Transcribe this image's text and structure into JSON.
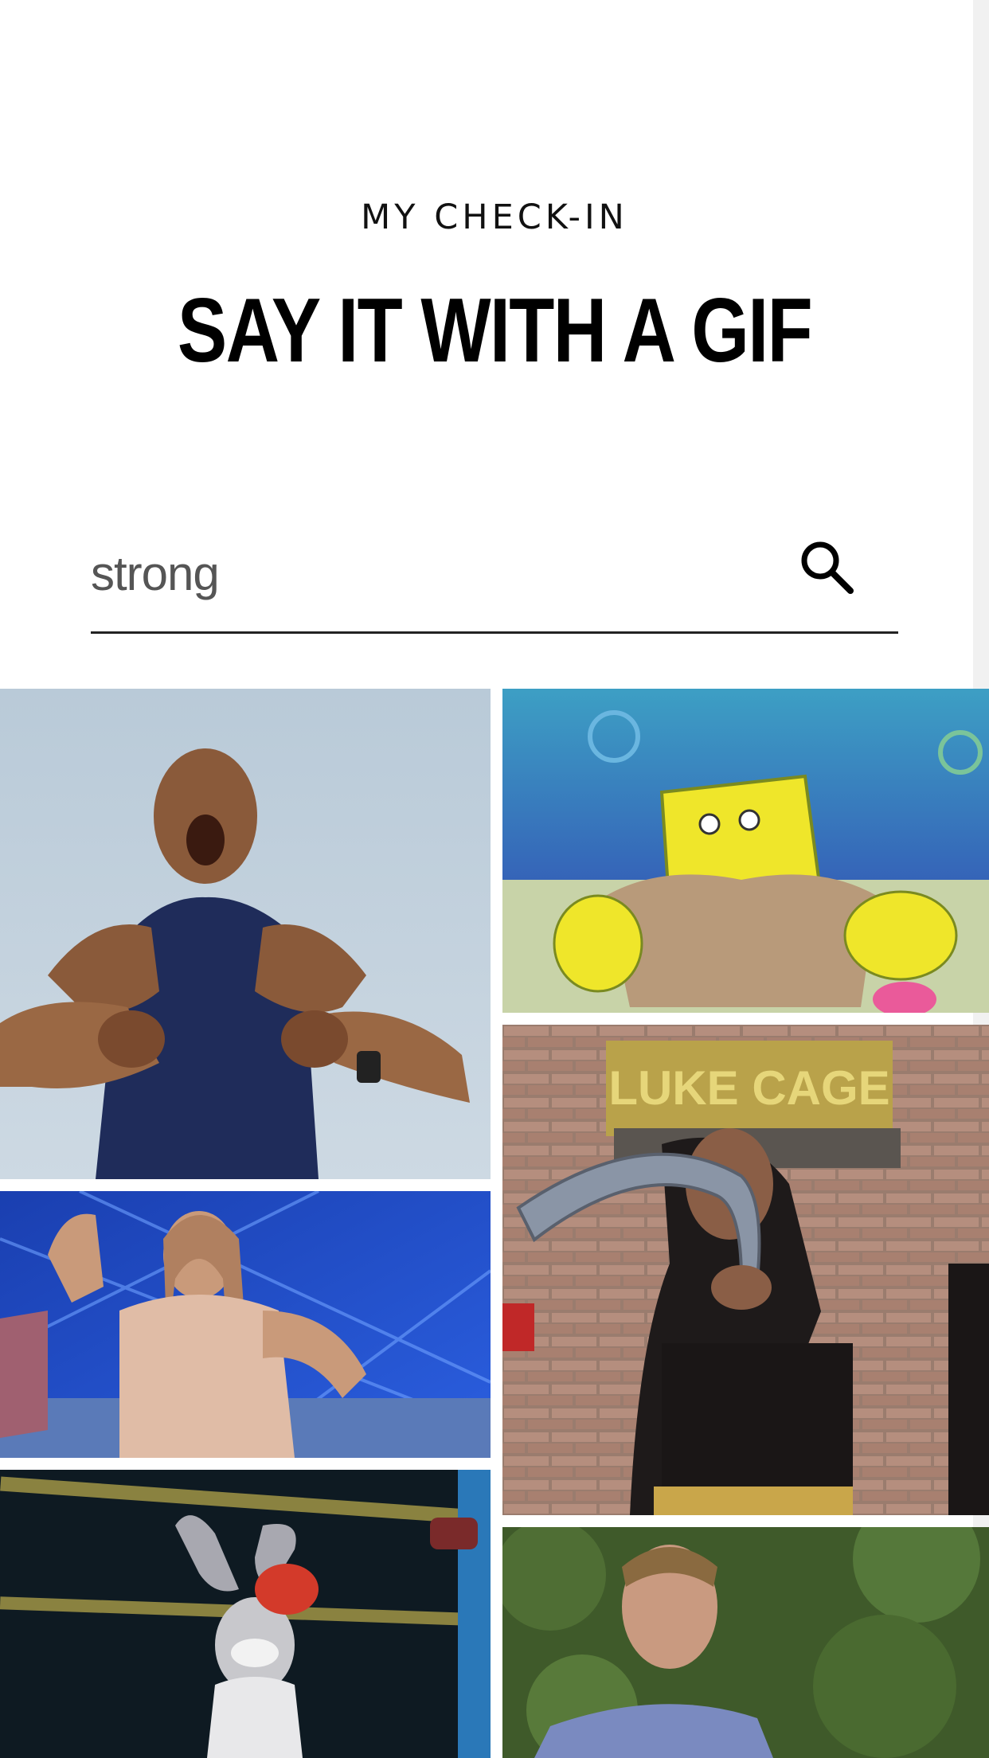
{
  "header": {
    "eyebrow": "MY CHECK-IN",
    "title": "SAY IT WITH A GIF"
  },
  "search": {
    "value": "strong",
    "icon": "search-icon"
  },
  "gifs": [
    {
      "name": "gif-rock-flexing",
      "column": "left"
    },
    {
      "name": "gif-spongebob-muscles",
      "column": "right"
    },
    {
      "name": "gif-luke-cage-bending-pipe",
      "column": "right"
    },
    {
      "name": "gif-jlo-flexing",
      "column": "left"
    },
    {
      "name": "gif-bugs-bunny-boxing",
      "column": "left"
    },
    {
      "name": "gif-chris-evans-running",
      "column": "right"
    }
  ],
  "luke_cage_sign": "LUKE CAGE",
  "colors": {
    "background": "#ffffff",
    "text": "#000000",
    "search_line": "#222222"
  }
}
